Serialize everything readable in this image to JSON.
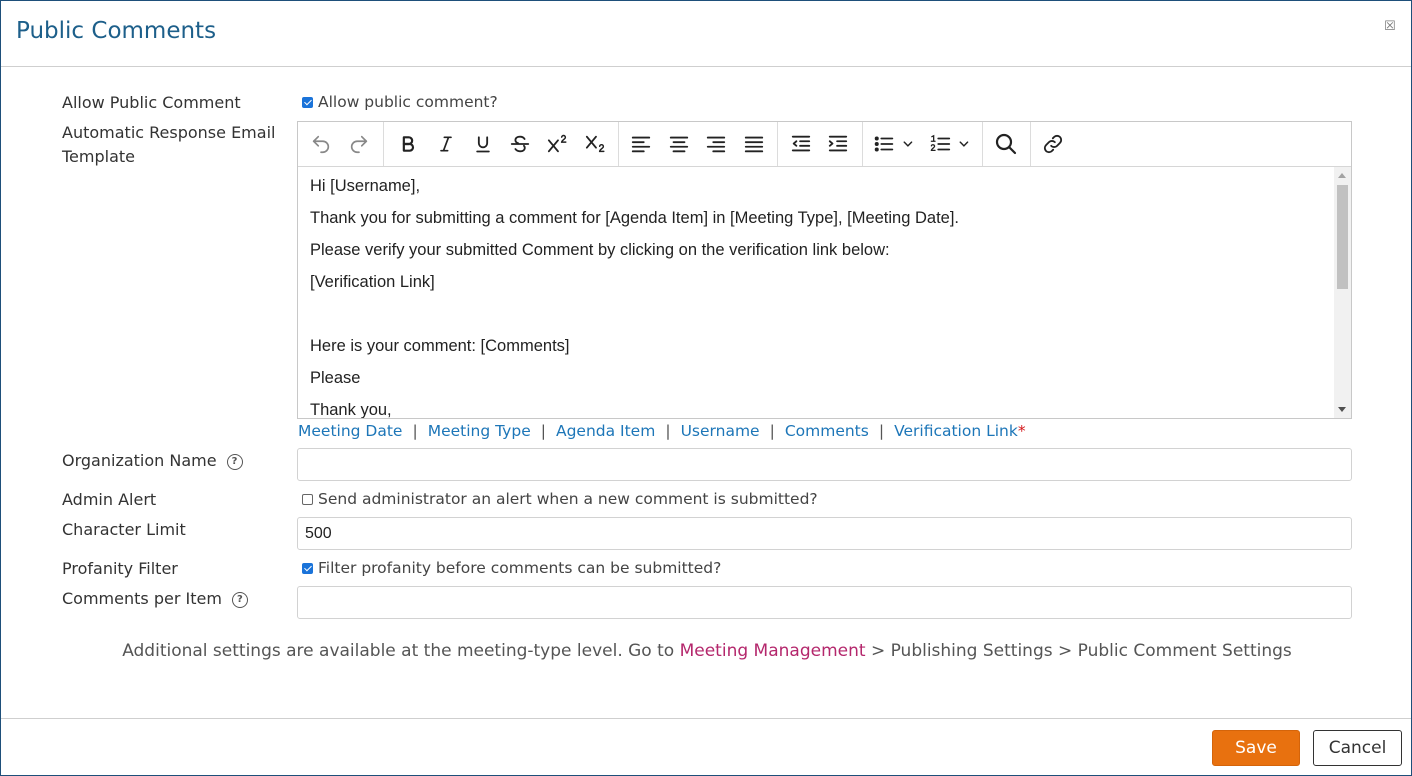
{
  "dialog": {
    "title": "Public Comments",
    "close_icon": "close-icon"
  },
  "fields": {
    "allow_public_comment": {
      "label": "Allow Public Comment",
      "checkbox_label": "Allow public comment?",
      "checked": true
    },
    "auto_response": {
      "label": "Automatic Response Email Template"
    },
    "organization_name": {
      "label": "Organization Name",
      "value": ""
    },
    "admin_alert": {
      "label": "Admin Alert",
      "checkbox_label": "Send administrator an alert when a new comment is submitted?",
      "checked": false
    },
    "character_limit": {
      "label": "Character Limit",
      "value": "500"
    },
    "profanity_filter": {
      "label": "Profanity Filter",
      "checkbox_label": "Filter profanity before comments can be submitted?",
      "checked": true
    },
    "comments_per_item": {
      "label": "Comments per Item",
      "value": ""
    }
  },
  "editor": {
    "toolbar": [
      "undo-icon",
      "redo-icon",
      "bold-icon",
      "italic-icon",
      "underline-icon",
      "strikethrough-icon",
      "superscript-icon",
      "subscript-icon",
      "align-left-icon",
      "align-center-icon",
      "align-right-icon",
      "align-justify-icon",
      "outdent-icon",
      "indent-icon",
      "bullet-list-icon",
      "numbered-list-icon",
      "search-icon",
      "link-icon"
    ],
    "lines": [
      "Hi [Username],",
      "Thank you for submitting a comment for [Agenda Item] in [Meeting Type], [Meeting Date].",
      "Please verify your submitted Comment by clicking on the verification link below:",
      "[Verification Link]",
      "",
      "Here is your comment: [Comments]",
      "Please",
      "Thank you,"
    ]
  },
  "tokens": [
    "Meeting Date",
    "Meeting Type",
    "Agenda Item",
    "Username",
    "Comments",
    "Verification Link"
  ],
  "tokens_separator": "|",
  "tokens_required_mark": "*",
  "note": {
    "prefix": "Additional settings are available at the meeting-type level. Go to",
    "link": "Meeting Management",
    "suffix": "> Publishing Settings > Public Comment Settings"
  },
  "buttons": {
    "save": "Save",
    "cancel": "Cancel"
  },
  "colors": {
    "accent": "#e8710f",
    "title": "#1d5f8a",
    "token_link": "#1d76b8",
    "note_link": "#b4276c",
    "checkbox": "#1a73d9"
  }
}
